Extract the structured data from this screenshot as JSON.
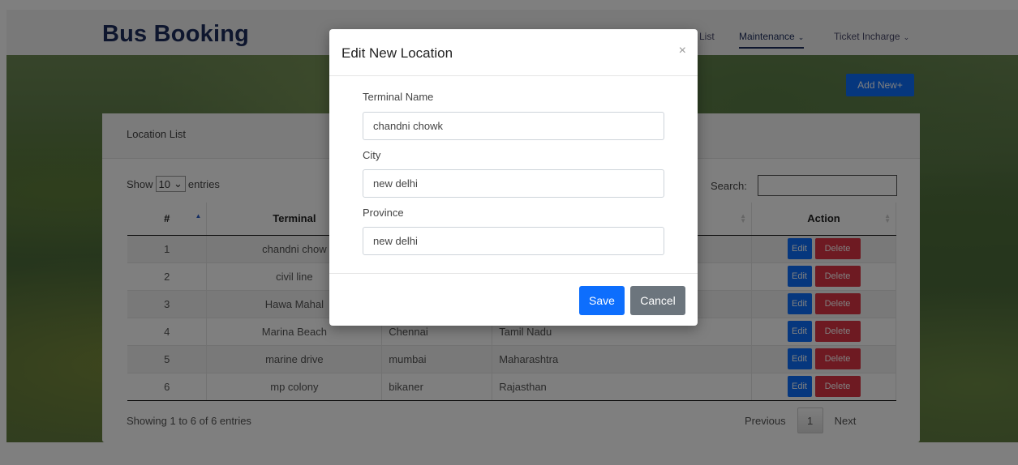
{
  "navbar": {
    "brand": "Bus Booking",
    "links": [
      {
        "label": "d List"
      },
      {
        "label": "Maintenance",
        "caret": "⌄"
      },
      {
        "label": "Ticket Incharge",
        "caret": "⌄"
      }
    ]
  },
  "toolbar": {
    "add_new_label": "Add New",
    "add_icon": "+"
  },
  "card": {
    "title": "Location List",
    "show_label": "Show",
    "entries_value": "10",
    "entries_label": "entries",
    "search_label": "Search:",
    "search_value": ""
  },
  "table": {
    "headers": [
      "#",
      "Terminal",
      "",
      "",
      "Action"
    ],
    "rows": [
      {
        "num": "1",
        "terminal": "chandni chow",
        "city": "",
        "province": "",
        "edit": "Edit",
        "delete": "Delete"
      },
      {
        "num": "2",
        "terminal": "civil line",
        "city": "",
        "province": "",
        "edit": "Edit",
        "delete": "Delete"
      },
      {
        "num": "3",
        "terminal": "Hawa Mahal",
        "city": "",
        "province": "",
        "edit": "Edit",
        "delete": "Delete"
      },
      {
        "num": "4",
        "terminal": "Marina Beach",
        "city": "Chennai",
        "province": "Tamil Nadu",
        "edit": "Edit",
        "delete": "Delete"
      },
      {
        "num": "5",
        "terminal": "marine drive",
        "city": "mumbai",
        "province": "Maharashtra",
        "edit": "Edit",
        "delete": "Delete"
      },
      {
        "num": "6",
        "terminal": "mp colony",
        "city": "bikaner",
        "province": "Rajasthan",
        "edit": "Edit",
        "delete": "Delete"
      }
    ]
  },
  "footer": {
    "info": "Showing 1 to 6 of 6 entries",
    "previous": "Previous",
    "page": "1",
    "next": "Next"
  },
  "modal": {
    "title": "Edit New Location",
    "close_icon": "×",
    "fields": [
      {
        "label": "Terminal Name",
        "value": "chandni chowk"
      },
      {
        "label": "City",
        "value": "new delhi"
      },
      {
        "label": "Province",
        "value": "new delhi"
      }
    ],
    "save_label": "Save",
    "cancel_label": "Cancel"
  },
  "colors": {
    "brand": "#1d2d5c",
    "primary": "#0d6efd",
    "danger": "#dc3545",
    "secondary": "#6c757d"
  }
}
